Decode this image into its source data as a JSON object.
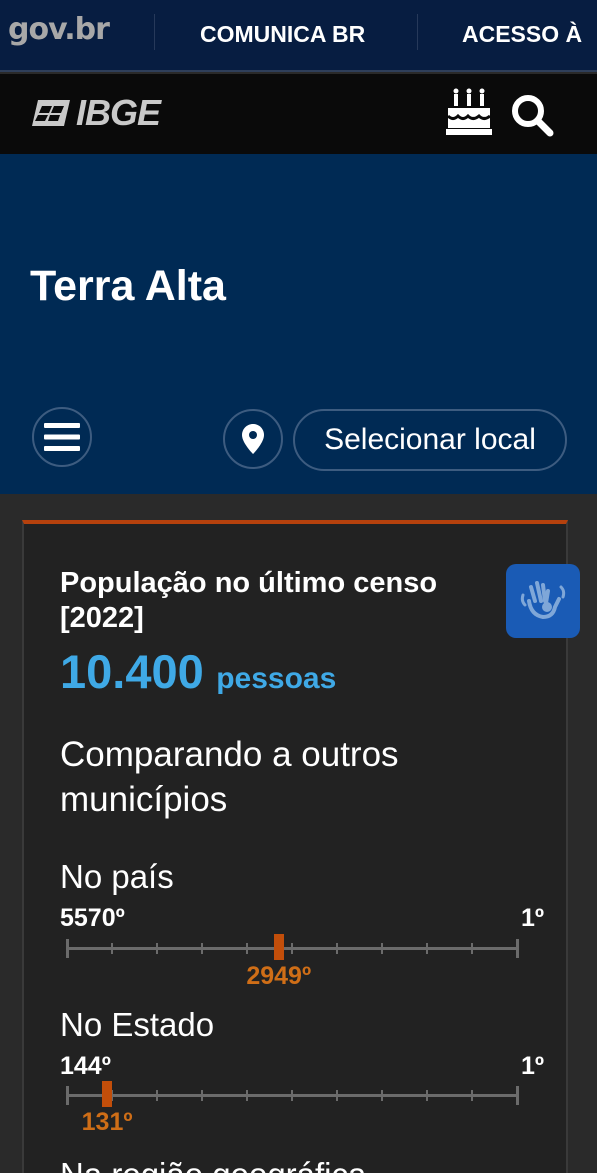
{
  "govbar": {
    "logo": "gov.br",
    "links": [
      "COMUNICA BR",
      "ACESSO À"
    ]
  },
  "ibgebar": {
    "logo": "IBGE",
    "icons": [
      "birthday-cake-icon",
      "search-icon"
    ]
  },
  "header": {
    "title": "Terra Alta",
    "menu_icon": "hamburger-menu-icon",
    "location_icon": "map-pin-icon",
    "select_label": "Selecionar local"
  },
  "card": {
    "label": "População no último censo [2022]",
    "value": "10.400",
    "unit": "pessoas",
    "libras_icon": "sign-language-hands-icon",
    "compare_title": "Comparando a outros municípios",
    "rankings": [
      {
        "label": "No país",
        "min": "5570º",
        "max": "1º",
        "current": "2949º",
        "total": 5570,
        "position": 2949
      },
      {
        "label": "No Estado",
        "min": "144º",
        "max": "1º",
        "current": "131º",
        "total": 144,
        "position": 131
      }
    ],
    "next_label": "Na região geográfica"
  },
  "colors": {
    "govbar": "#071d41",
    "hero": "#002a54",
    "accent_value": "#3fa9e6",
    "accent_rank": "#c24e0a",
    "card_top_border": "#b5410d"
  }
}
